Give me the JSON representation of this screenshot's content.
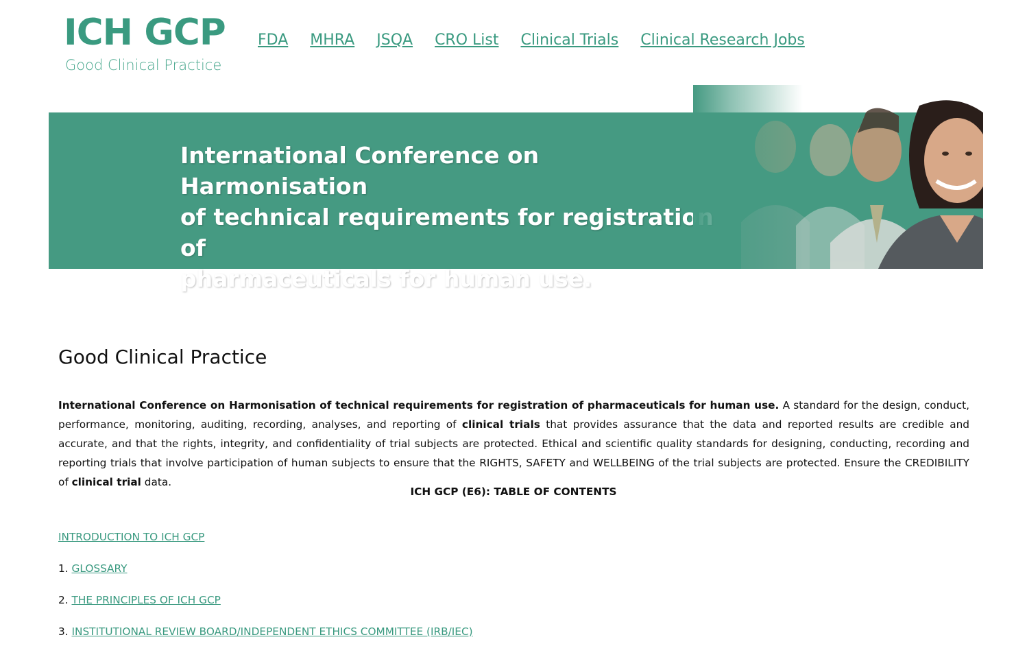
{
  "logo": {
    "title": "ICH GCP",
    "subtitle": "Good Clinical Practice"
  },
  "nav": {
    "items": [
      {
        "label": "FDA"
      },
      {
        "label": "MHRA"
      },
      {
        "label": "JSQA"
      },
      {
        "label": "CRO List"
      },
      {
        "label": "Clinical Trials"
      },
      {
        "label": "Clinical Research Jobs"
      }
    ]
  },
  "banner": {
    "line1": "International Conference on Harmonisation",
    "line2": "of technical requirements for registration of",
    "line3": "pharmaceuticals for human use."
  },
  "main": {
    "title": "Good Clinical Practice",
    "intro": {
      "bold_lead": "International Conference on Harmonisation of technical requirements for registration of pharmaceuticals for human use.",
      "part1": " A standard for the design, conduct, performance, monitoring, auditing, recording, analyses, and reporting of ",
      "bold_clinical_trials": "clinical trials",
      "part2": " that provides assurance that the data and reported results are credible and accurate, and that the rights, integrity, and confidentiality of trial subjects are protected. Ethical and scientific quality standards for designing, conducting, recording and reporting trials that involve participation of human subjects to ensure that the RIGHTS, SAFETY and WELLBEING of the trial subjects are protected. Ensure the CREDIBILITY of ",
      "bold_clinical_trial": "clinical trial",
      "part3": " data."
    },
    "toc_heading": "ICH GCP (E6): TABLE OF CONTENTS",
    "toc": [
      {
        "number": "",
        "label": "INTRODUCTION TO ICH GCP"
      },
      {
        "number": "1.",
        "label": "GLOSSARY"
      },
      {
        "number": "2.",
        "label": "THE PRINCIPLES OF ICH GCP"
      },
      {
        "number": "3.",
        "label": "INSTITUTIONAL REVIEW BOARD/INDEPENDENT ETHICS COMMITTEE (IRB/IEC)"
      }
    ]
  },
  "colors": {
    "brand": "#3a9a80",
    "banner": "#459a82"
  }
}
